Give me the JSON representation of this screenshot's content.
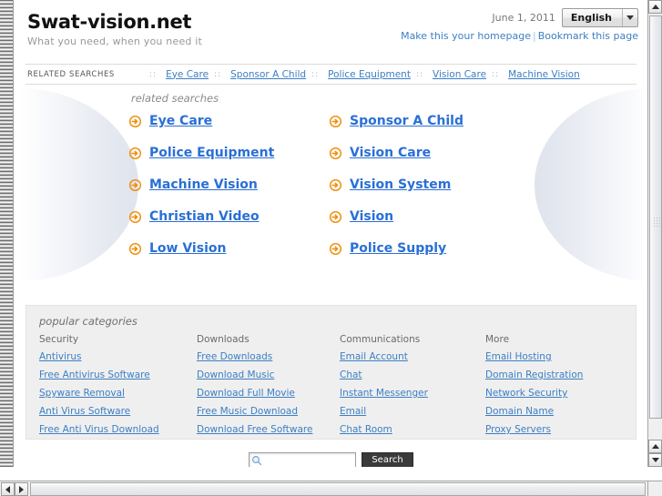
{
  "header": {
    "site_title": "Swat-vision.net",
    "tagline": "What you need, when you need it",
    "date": "June 1, 2011",
    "language": "English",
    "homepage_link": "Make this your homepage",
    "separator": "|",
    "bookmark_link": "Bookmark this page"
  },
  "related_strip": {
    "label": "RELATED SEARCHES",
    "dots": "::",
    "items": [
      "Eye Care",
      "Sponsor A Child",
      "Police Equipment",
      "Vision Care",
      "Machine Vision"
    ]
  },
  "main": {
    "heading": "related searches",
    "links": [
      "Eye Care",
      "Sponsor A Child",
      "Police Equipment",
      "Vision Care",
      "Machine Vision",
      "Vision System",
      "Christian Video",
      "Vision",
      "Low Vision",
      "Police Supply"
    ]
  },
  "categories": {
    "heading": "popular categories",
    "columns": [
      {
        "title": "Security",
        "links": [
          "Antivirus",
          "Free Antivirus Software",
          "Spyware Removal",
          "Anti Virus Software",
          "Free Anti Virus Download"
        ]
      },
      {
        "title": "Downloads",
        "links": [
          "Free Downloads",
          "Download Music",
          "Download Full Movie",
          "Free Music Download",
          "Download Free Software"
        ]
      },
      {
        "title": "Communications",
        "links": [
          "Email Account",
          "Chat",
          "Instant Messenger",
          "Email",
          "Chat Room"
        ]
      },
      {
        "title": "More",
        "links": [
          "Email Hosting",
          "Domain Registration",
          "Network Security",
          "Domain Name",
          "Proxy Servers"
        ]
      }
    ]
  },
  "search": {
    "value": "",
    "placeholder": "",
    "button_label": "Search"
  },
  "icons": {
    "arrow_circle": "arrow-circle-right-icon",
    "magnifier": "search-icon",
    "chevron": "chevron-down-icon"
  },
  "colors": {
    "link_blue": "#3c7fc4",
    "main_link_blue": "#2a6fd6",
    "arrow_orange": "#f08a00",
    "category_bg": "#efefef"
  }
}
